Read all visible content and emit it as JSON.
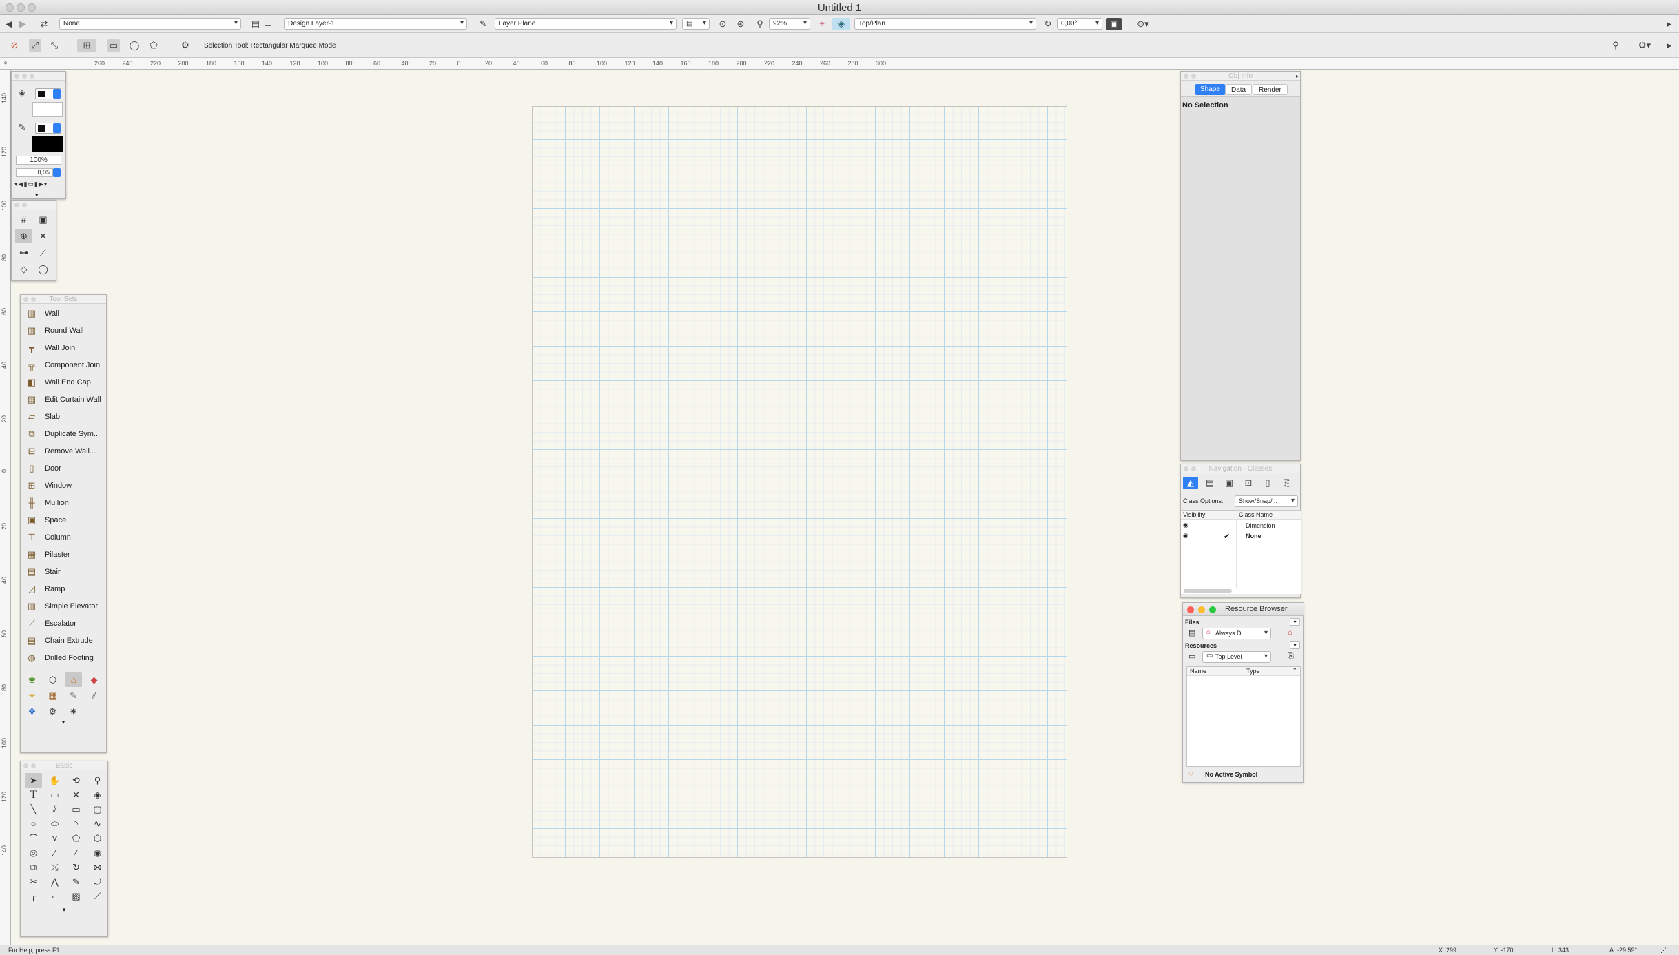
{
  "window": {
    "title": "Untitled 1"
  },
  "viewbar": {
    "class_dropdown": "None",
    "layer_dropdown": "Design Layer-1",
    "plane_dropdown": "Layer Plane",
    "zoom_dropdown": "92%",
    "view_dropdown": "Top/Plan",
    "rotation_field": "0,00°"
  },
  "modebar": {
    "mode_text": "Selection Tool: Rectangular Marquee Mode"
  },
  "ruler_h": {
    "labels": [
      "260",
      "240",
      "220",
      "200",
      "180",
      "160",
      "140",
      "120",
      "100",
      "80",
      "60",
      "40",
      "20",
      "0",
      "20",
      "40",
      "60",
      "80",
      "100",
      "120",
      "140",
      "160",
      "180",
      "200",
      "220",
      "240",
      "260",
      "280",
      "300"
    ]
  },
  "ruler_v": {
    "labels": [
      "140",
      "120",
      "100",
      "80",
      "60",
      "40",
      "20",
      "0",
      "20",
      "40",
      "60",
      "80",
      "100",
      "120",
      "140"
    ]
  },
  "attributes": {
    "opacity": "100%",
    "line_weight": "0,05"
  },
  "toolsets": {
    "title": "Tool Sets",
    "items": [
      {
        "label": "Wall",
        "icon": "wall-icon"
      },
      {
        "label": "Round Wall",
        "icon": "round-wall-icon"
      },
      {
        "label": "Wall Join",
        "icon": "wall-join-icon"
      },
      {
        "label": "Component Join",
        "icon": "component-join-icon"
      },
      {
        "label": "Wall End Cap",
        "icon": "wall-end-cap-icon"
      },
      {
        "label": "Edit Curtain Wall",
        "icon": "curtain-wall-icon"
      },
      {
        "label": "Slab",
        "icon": "slab-icon"
      },
      {
        "label": "Duplicate Sym...",
        "icon": "duplicate-symbol-icon"
      },
      {
        "label": "Remove Wall...",
        "icon": "remove-wall-icon"
      },
      {
        "label": "Door",
        "icon": "door-icon"
      },
      {
        "label": "Window",
        "icon": "window-icon"
      },
      {
        "label": "Mullion",
        "icon": "mullion-icon"
      },
      {
        "label": "Space",
        "icon": "space-icon"
      },
      {
        "label": "Column",
        "icon": "column-icon"
      },
      {
        "label": "Pilaster",
        "icon": "pilaster-icon"
      },
      {
        "label": "Stair",
        "icon": "stair-icon"
      },
      {
        "label": "Ramp",
        "icon": "ramp-icon"
      },
      {
        "label": "Simple Elevator",
        "icon": "elevator-icon"
      },
      {
        "label": "Escalator",
        "icon": "escalator-icon"
      },
      {
        "label": "Chain Extrude",
        "icon": "chain-extrude-icon"
      },
      {
        "label": "Drilled Footing",
        "icon": "drilled-footing-icon"
      }
    ]
  },
  "basic": {
    "title": "Basic"
  },
  "objinfo": {
    "title": "Obj Info",
    "tabs": [
      "Shape",
      "Data",
      "Render"
    ],
    "no_selection": "No Selection"
  },
  "navigation": {
    "title": "Navigation - Classes",
    "class_options_label": "Class Options:",
    "class_options_value": "Show/Snap/...",
    "col_visibility": "Visibility",
    "col_class_name": "Class Name",
    "rows": [
      {
        "name": "Dimension",
        "active": ""
      },
      {
        "name": "None",
        "active": "✔"
      }
    ]
  },
  "resource_browser": {
    "title": "Resource Browser",
    "files_label": "Files",
    "files_value": "Always D...",
    "resources_label": "Resources",
    "resources_value": "Top Level",
    "col_name": "Name",
    "col_type": "Type",
    "active_symbol": "No Active Symbol"
  },
  "statusbar": {
    "help": "For Help, press F1",
    "x": "X: 299",
    "y": "Y: -170",
    "l": "L: 343",
    "a": "A: -29,59°"
  },
  "colors": {
    "accent": "#2f7ff5",
    "grid": "#b6d6ea",
    "canvas": "#f6f5ec"
  }
}
